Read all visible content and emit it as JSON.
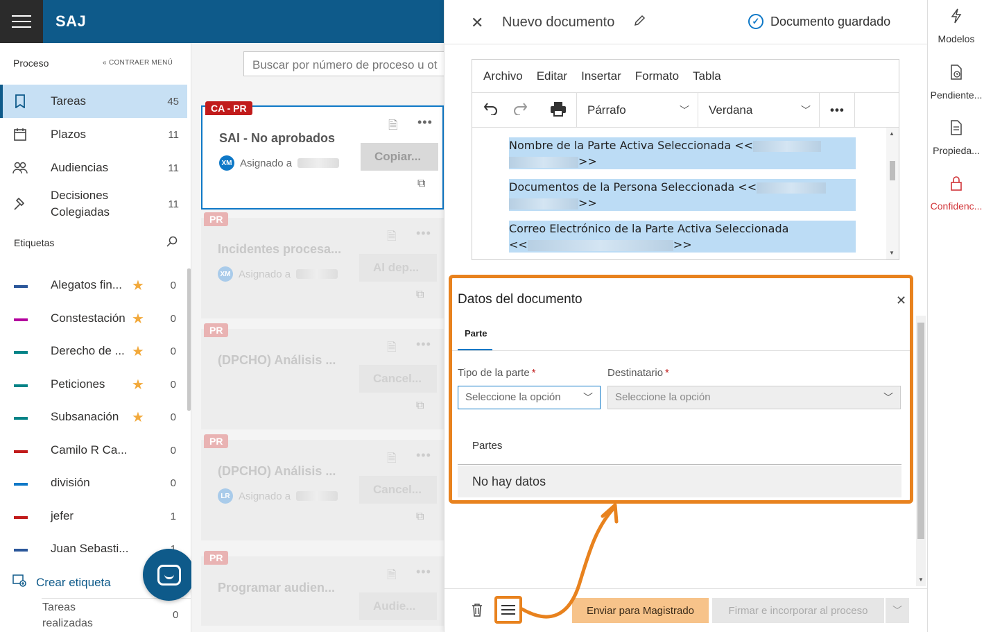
{
  "app": {
    "brand": "SAJ"
  },
  "sidebar": {
    "header": "Proceso",
    "collapse_label": "CONTRAER MENÚ",
    "nav": [
      {
        "label": "Tareas",
        "count": "45"
      },
      {
        "label": "Plazos",
        "count": "11"
      },
      {
        "label": "Audiencias",
        "count": "11"
      },
      {
        "label": "Decisiones Colegiadas",
        "count": "11"
      }
    ],
    "tags_header": "Etiquetas",
    "tags": [
      {
        "label": "Alegatos fin...",
        "count": "0",
        "color": "#2b579a",
        "starred": true
      },
      {
        "label": "Constestación",
        "count": "0",
        "color": "#b4009e",
        "starred": true
      },
      {
        "label": "Derecho de ...",
        "count": "0",
        "color": "#038387",
        "starred": true
      },
      {
        "label": "Peticiones",
        "count": "0",
        "color": "#038387",
        "starred": true
      },
      {
        "label": "Subsanación",
        "count": "0",
        "color": "#038387",
        "starred": true
      },
      {
        "label": "Camilo R Ca...",
        "count": "0",
        "color": "#c11b1b",
        "starred": false
      },
      {
        "label": "división",
        "count": "0",
        "color": "#0e78c7",
        "starred": false
      },
      {
        "label": "jefer",
        "count": "1",
        "color": "#c11b1b",
        "starred": false
      },
      {
        "label": "Juan Sebasti...",
        "count": "1",
        "color": "#2b579a",
        "starred": false
      }
    ],
    "create_tag": "Crear etiqueta",
    "done_tasks": "Tareas realizadas",
    "done_count": "0"
  },
  "middle": {
    "search_placeholder": "Buscar por número de proceso u ot",
    "cards": [
      {
        "tag": "CA - PR",
        "title": "SAI - No aprobados",
        "assigned": "Asignado a",
        "initials": "XM",
        "action": "Copiar..."
      },
      {
        "tag": "PR",
        "title": "Incidentes procesa...",
        "assigned": "Asignado a",
        "initials": "XM",
        "action": "Al dep..."
      },
      {
        "tag": "PR",
        "title": "(DPCHO) Análisis ...",
        "assigned": "",
        "initials": "",
        "action": "Cancel..."
      },
      {
        "tag": "PR",
        "title": "(DPCHO) Análisis ...",
        "assigned": "Asignado a",
        "initials": "LR",
        "action": "Cancel..."
      },
      {
        "tag": "PR",
        "title": "Programar audien...",
        "assigned": "",
        "initials": "",
        "action": "Audie..."
      }
    ]
  },
  "panel": {
    "title": "Nuevo documento",
    "saved_status": "Documento guardado",
    "menu": [
      "Archivo",
      "Editar",
      "Insertar",
      "Formato",
      "Tabla"
    ],
    "format_select": "Párrafo",
    "font_select": "Verdana",
    "body": [
      {
        "text": "Nombre de la Parte Activa Seleccionada <<",
        "end": ">>"
      },
      {
        "text": "Documentos de la Persona Seleccionada <<",
        "end": ">>"
      },
      {
        "text": "Correo Electrónico de la Parte Activa Seleccionada",
        "start": "<<",
        "end": ">>"
      }
    ],
    "dialog": {
      "title": "Datos del documento",
      "tab": "Parte",
      "field1_label": "Tipo de la parte",
      "field1_value": "Seleccione la opción",
      "field2_label": "Destinatario",
      "field2_value": "Seleccione la opción",
      "table_header": "Partes",
      "empty": "No hay datos"
    },
    "send_button": "Enviar para Magistrado",
    "sign_button": "Firmar e incorporar al proceso"
  },
  "rail": {
    "items": [
      {
        "label": "Modelos",
        "icon": "lightning-icon"
      },
      {
        "label": "Pendiente...",
        "icon": "doc-clock-icon"
      },
      {
        "label": "Propieda...",
        "icon": "doc-properties-icon"
      },
      {
        "label": "Confidenc...",
        "icon": "lock-icon"
      }
    ]
  },
  "colors": {
    "brand": "#0e5a8a",
    "accent": "#0e78c7",
    "highlight": "#e8821e",
    "danger": "#c11b1b"
  }
}
